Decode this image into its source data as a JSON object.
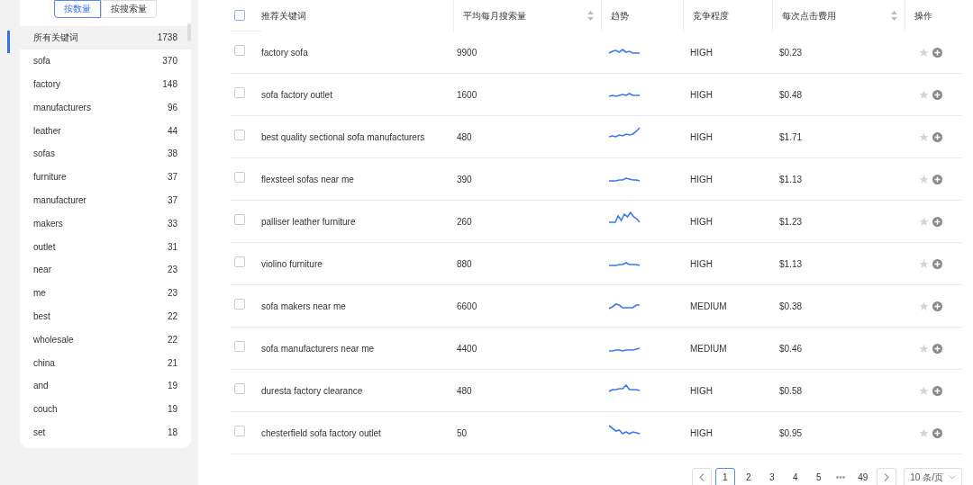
{
  "segments": [
    {
      "label": "按数量",
      "selected": true
    },
    {
      "label": "按搜索量",
      "selected": false
    }
  ],
  "keyword_groups": [
    {
      "label": "所有关键词",
      "count": "1738",
      "selected": true
    },
    {
      "label": "sofa",
      "count": "370",
      "selected": false
    },
    {
      "label": "factory",
      "count": "148",
      "selected": false
    },
    {
      "label": "manufacturers",
      "count": "96",
      "selected": false
    },
    {
      "label": "leather",
      "count": "44",
      "selected": false
    },
    {
      "label": "sofas",
      "count": "38",
      "selected": false
    },
    {
      "label": "furniture",
      "count": "37",
      "selected": false
    },
    {
      "label": "manufacturer",
      "count": "37",
      "selected": false
    },
    {
      "label": "makers",
      "count": "33",
      "selected": false
    },
    {
      "label": "outlet",
      "count": "31",
      "selected": false
    },
    {
      "label": "near",
      "count": "23",
      "selected": false
    },
    {
      "label": "me",
      "count": "23",
      "selected": false
    },
    {
      "label": "best",
      "count": "22",
      "selected": false
    },
    {
      "label": "wholesale",
      "count": "22",
      "selected": false
    },
    {
      "label": "china",
      "count": "21",
      "selected": false
    },
    {
      "label": "and",
      "count": "19",
      "selected": false
    },
    {
      "label": "couch",
      "count": "19",
      "selected": false
    },
    {
      "label": "set",
      "count": "18",
      "selected": false
    }
  ],
  "table": {
    "select_all": {
      "checked": false
    },
    "columns": [
      {
        "label": "推荐关键词",
        "sortable": false
      },
      {
        "label": "平均每月搜索量",
        "sortable": true
      },
      {
        "label": "趋势",
        "sortable": false
      },
      {
        "label": "竞争程度",
        "sortable": false
      },
      {
        "label": "每次点击费用",
        "sortable": true
      },
      {
        "label": "操作",
        "sortable": false
      }
    ],
    "rows": [
      {
        "checked": false,
        "keyword": "factory sofa",
        "volume": "9900",
        "competition": "HIGH",
        "cpc": "$0.23"
      },
      {
        "checked": false,
        "keyword": "sofa factory outlet",
        "volume": "1600",
        "competition": "HIGH",
        "cpc": "$0.48"
      },
      {
        "checked": false,
        "keyword": "best quality sectional sofa manufacturers",
        "volume": "480",
        "competition": "HIGH",
        "cpc": "$1.71"
      },
      {
        "checked": false,
        "keyword": "flexsteel sofas near me",
        "volume": "390",
        "competition": "HIGH",
        "cpc": "$1.13"
      },
      {
        "checked": false,
        "keyword": "palliser leather furniture",
        "volume": "260",
        "competition": "HIGH",
        "cpc": "$1.23"
      },
      {
        "checked": false,
        "keyword": "violino furniture",
        "volume": "880",
        "competition": "HIGH",
        "cpc": "$1.13"
      },
      {
        "checked": false,
        "keyword": "sofa makers near me",
        "volume": "6600",
        "competition": "MEDIUM",
        "cpc": "$0.38"
      },
      {
        "checked": false,
        "keyword": "sofa manufacturers near me",
        "volume": "4400",
        "competition": "MEDIUM",
        "cpc": "$0.46"
      },
      {
        "checked": false,
        "keyword": "duresta factory clearance",
        "volume": "480",
        "competition": "HIGH",
        "cpc": "$0.58"
      },
      {
        "checked": false,
        "keyword": "chesterfield sofa factory outlet",
        "volume": "50",
        "competition": "HIGH",
        "cpc": "$0.95"
      }
    ]
  },
  "pagination": {
    "pages": [
      {
        "label": "1",
        "selected": true
      },
      {
        "label": "2",
        "selected": false
      },
      {
        "label": "3",
        "selected": false
      },
      {
        "label": "4",
        "selected": false
      },
      {
        "label": "5",
        "selected": false
      }
    ],
    "ellipsis": "•••",
    "last_page": "49",
    "page_size": "10 条/页"
  }
}
